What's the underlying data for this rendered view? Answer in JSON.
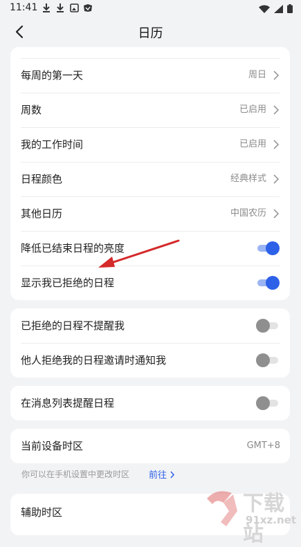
{
  "status_bar": {
    "time": "11:41",
    "left_icons": [
      "download-icon",
      "download-icon",
      "image-icon",
      "app-icon"
    ],
    "right_icons": [
      "wifi-icon",
      "signal-icon",
      "battery-icon"
    ]
  },
  "header": {
    "title": "日历",
    "back_icon": "chevron-left-icon"
  },
  "group1": [
    {
      "label": "每周的第一天",
      "value": "周日"
    },
    {
      "label": "周数",
      "value": "已启用"
    },
    {
      "label": "我的工作时间",
      "value": "已启用"
    },
    {
      "label": "日程颜色",
      "value": "经典样式"
    },
    {
      "label": "其他日历",
      "value": "中国农历"
    },
    {
      "label": "降低已结束日程的亮度",
      "toggle": true
    },
    {
      "label": "显示我已拒绝的日程",
      "toggle": true
    }
  ],
  "group2": [
    {
      "label": "已拒绝的日程不提醒我",
      "toggle": false
    },
    {
      "label": "他人拒绝我的日程邀请时通知我",
      "toggle": false
    }
  ],
  "group3": [
    {
      "label": "在消息列表提醒日程",
      "toggle": false
    }
  ],
  "timezone": {
    "label": "当前设备时区",
    "value": "GMT+8"
  },
  "hint": {
    "text": "你可以在手机设置中更改时区",
    "link": "前往"
  },
  "aux_timezone": {
    "label": "辅助时区"
  },
  "watermark": {
    "big": "下载站",
    "small": "91xz.net"
  },
  "colors": {
    "accent": "#2d61e8",
    "toggle_track_on": "#9bb4f3",
    "annotation_arrow": "#d42a2a",
    "background": "#f2f3f5"
  }
}
